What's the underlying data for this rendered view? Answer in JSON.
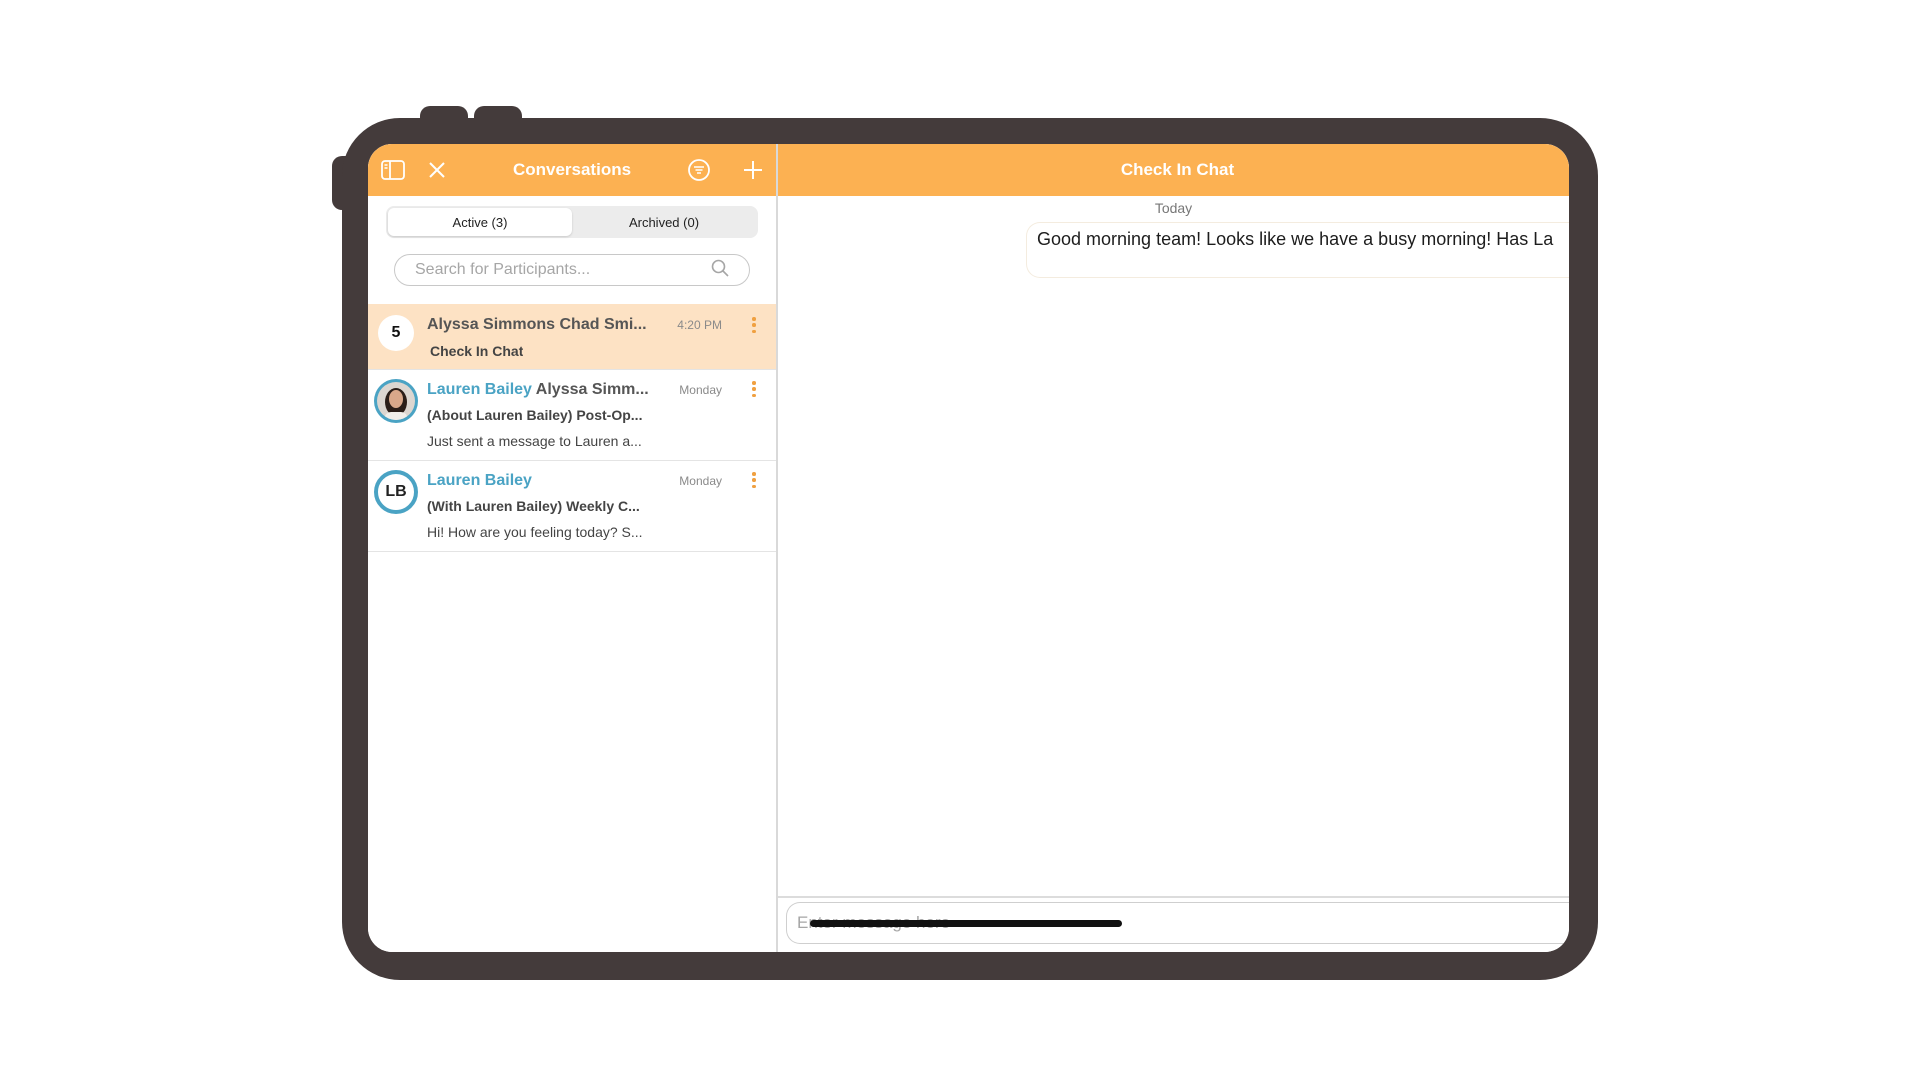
{
  "colors": {
    "accent": "#fcb152",
    "selected_row": "#fde2c4",
    "link_name": "#4aa3c4",
    "device_frame": "#443b3b"
  },
  "left_header": {
    "title": "Conversations",
    "icons": [
      "sidebar-toggle-icon",
      "close-icon",
      "filter-icon",
      "plus-icon"
    ]
  },
  "tabs": [
    {
      "label": "Active (3)",
      "selected": true
    },
    {
      "label": "Archived (0)",
      "selected": false
    }
  ],
  "search": {
    "placeholder": "Search for Participants...",
    "value": ""
  },
  "conversations": [
    {
      "badge": "5",
      "name_highlight": "",
      "name_rest": "Alyssa Simmons Chad Smi...",
      "subtitle": "Check In Chat",
      "preview": "",
      "time": "4:20 PM",
      "selected": true
    },
    {
      "avatar": "photo",
      "name_highlight": "Lauren Bailey",
      "name_rest": " Alyssa Simm...",
      "subtitle": "(About Lauren Bailey) Post-Op...",
      "preview": "Just sent a message to Lauren a...",
      "time": "Monday",
      "selected": false
    },
    {
      "avatar_initials": "LB",
      "name_highlight": "Lauren Bailey",
      "name_rest": "",
      "subtitle": "(With Lauren Bailey) Weekly C...",
      "preview": "Hi! How are you feeling today? S...",
      "time": "Monday",
      "selected": false
    }
  ],
  "chat": {
    "title": "Check In Chat",
    "day_label": "Today",
    "messages": [
      {
        "text": "Good morning team! Looks like we have a busy morning! Has La"
      }
    ],
    "composer_placeholder": "Enter message here"
  }
}
